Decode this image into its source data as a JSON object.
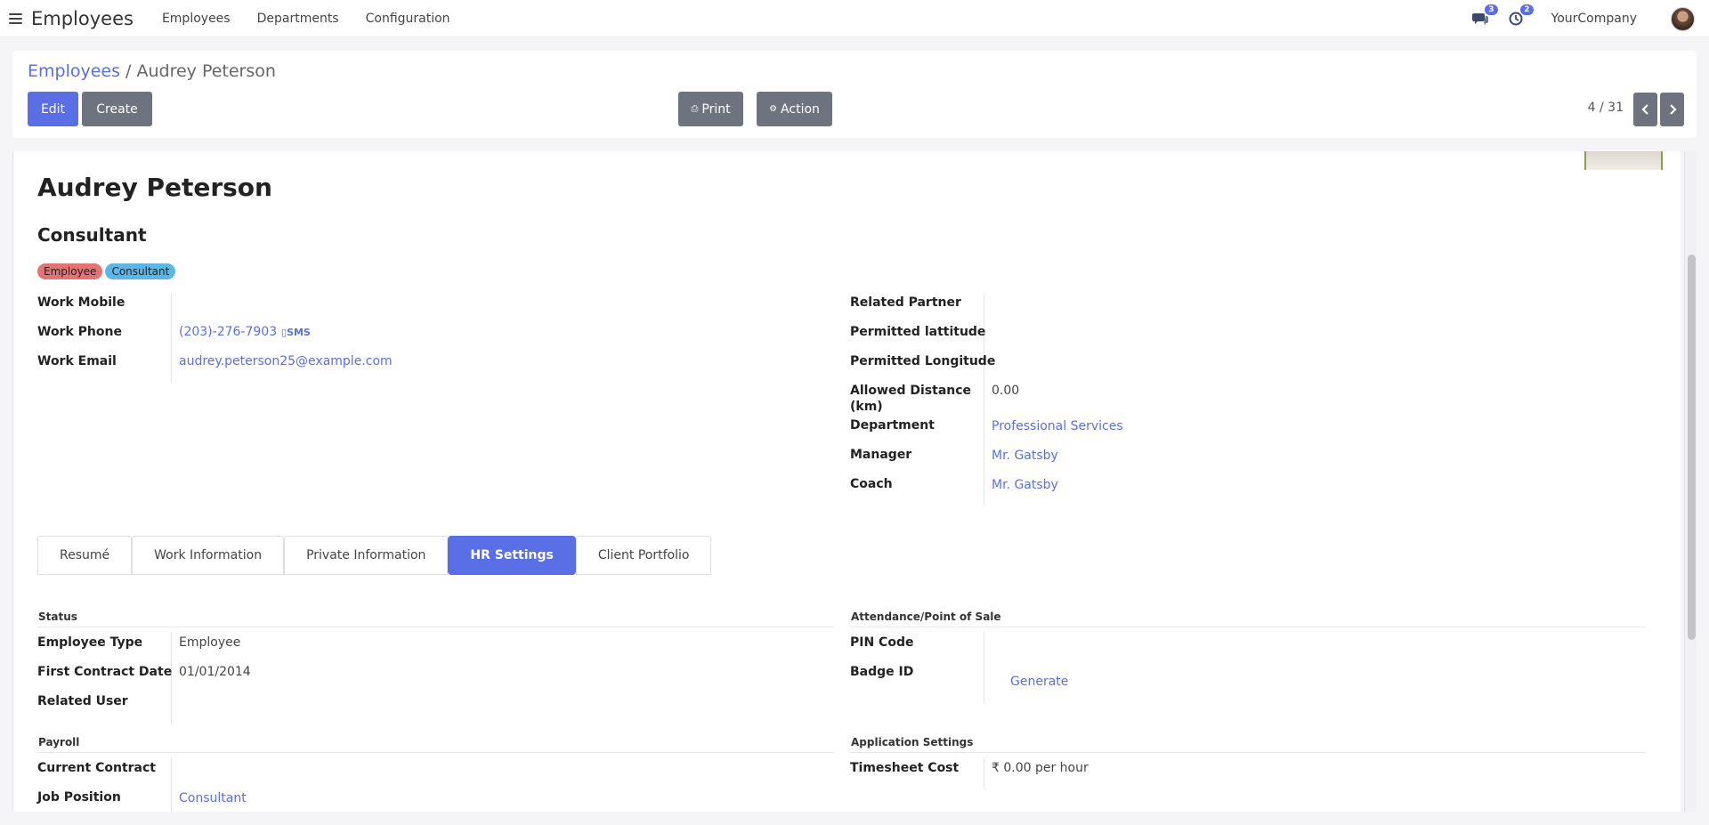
{
  "topbar": {
    "app_title": "Employees",
    "menu": [
      "Employees",
      "Departments",
      "Configuration"
    ],
    "messages_count": "3",
    "activities_count": "2",
    "company": "YourCompany"
  },
  "control_panel": {
    "breadcrumb_root": "Employees",
    "breadcrumb_sep": " / ",
    "breadcrumb_current": "Audrey Peterson",
    "edit_label": "Edit",
    "create_label": "Create",
    "print_label": "Print",
    "action_label": "Action",
    "pager": "4 / 31"
  },
  "employee": {
    "name": "Audrey Peterson",
    "job_title": "Consultant",
    "tags": [
      {
        "label": "Employee",
        "color": "#e57373"
      },
      {
        "label": "Consultant",
        "color": "#5bb7e8"
      }
    ]
  },
  "left_fields": {
    "work_mobile_label": "Work Mobile",
    "work_phone_label": "Work Phone",
    "work_phone_value": "(203)-276-7903",
    "sms_label": "SMS",
    "work_email_label": "Work Email",
    "work_email_value": "audrey.peterson25@example.com"
  },
  "right_fields": {
    "related_partner_label": "Related Partner",
    "permitted_lat_label": "Permitted lattitude",
    "permitted_long_label": "Permitted Longitude",
    "allowed_distance_label_1": "Allowed Distance",
    "allowed_distance_label_2": "(km)",
    "allowed_distance_value": "0.00",
    "department_label": "Department",
    "department_value": "Professional Services",
    "manager_label": "Manager",
    "manager_value": "Mr. Gatsby",
    "coach_label": "Coach",
    "coach_value": "Mr. Gatsby"
  },
  "tabs": [
    "Resumé",
    "Work Information",
    "Private Information",
    "HR Settings",
    "Client Portfolio"
  ],
  "active_tab": "HR Settings",
  "hr_settings": {
    "status_title": "Status",
    "employee_type_label": "Employee Type",
    "employee_type_value": "Employee",
    "first_contract_label": "First Contract Date",
    "first_contract_value": "01/01/2014",
    "related_user_label": "Related User",
    "attendance_title": "Attendance/Point of Sale",
    "pin_label": "PIN Code",
    "badge_label": "Badge ID",
    "generate_label": "Generate",
    "payroll_title": "Payroll",
    "current_contract_label": "Current Contract",
    "job_position_label": "Job Position",
    "job_position_value": "Consultant",
    "app_settings_title": "Application Settings",
    "timesheet_cost_label": "Timesheet Cost",
    "timesheet_cost_value": "₹ 0.00 per hour"
  },
  "colors": {
    "primary": "#5a6ee6",
    "secondary": "#6f7380"
  }
}
